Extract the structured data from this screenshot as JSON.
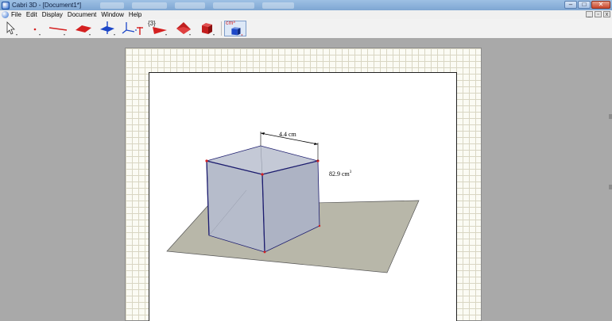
{
  "window": {
    "title": "Cabri 3D - [Document1*]",
    "controls": {
      "minimize": "–",
      "maximize": "□",
      "close": "✕"
    }
  },
  "menu": {
    "items": [
      "File",
      "Edit",
      "Display",
      "Document",
      "Window",
      "Help"
    ],
    "mdi_controls": {
      "minimize": "_",
      "restore": "▫",
      "close": "x"
    }
  },
  "toolbar": {
    "tools": [
      {
        "name": "pointer-tool",
        "icon": "arrow-pointer-icon"
      },
      {
        "name": "point-tool",
        "icon": "point-icon"
      },
      {
        "name": "line-tool",
        "icon": "line-icon"
      },
      {
        "name": "plane-tool",
        "icon": "plane-icon"
      },
      {
        "name": "perpendicular-tool",
        "icon": "perpendicular-icon"
      },
      {
        "name": "axes-tool",
        "icon": "axes-icon"
      },
      {
        "name": "transform-tool",
        "icon": "triangle-icon",
        "label": "{3}"
      },
      {
        "name": "polyhedron-tool",
        "icon": "polyhedron-icon"
      },
      {
        "name": "solid-tool",
        "icon": "cube-icon"
      },
      {
        "name": "measure-tool",
        "icon": "measure-cube-icon",
        "label": "cm³"
      }
    ],
    "colors": {
      "accent_red": "#d42020",
      "accent_blue": "#1c47c8"
    }
  },
  "scene": {
    "edge_label": "4.4 cm",
    "volume_value": "82.9 cm",
    "volume_unit_sup": "3",
    "colors": {
      "cube_face": "#b6bccb",
      "plane": "#b8b7a9",
      "edge": "#1c1c6e",
      "vertex": "#d42020"
    }
  }
}
